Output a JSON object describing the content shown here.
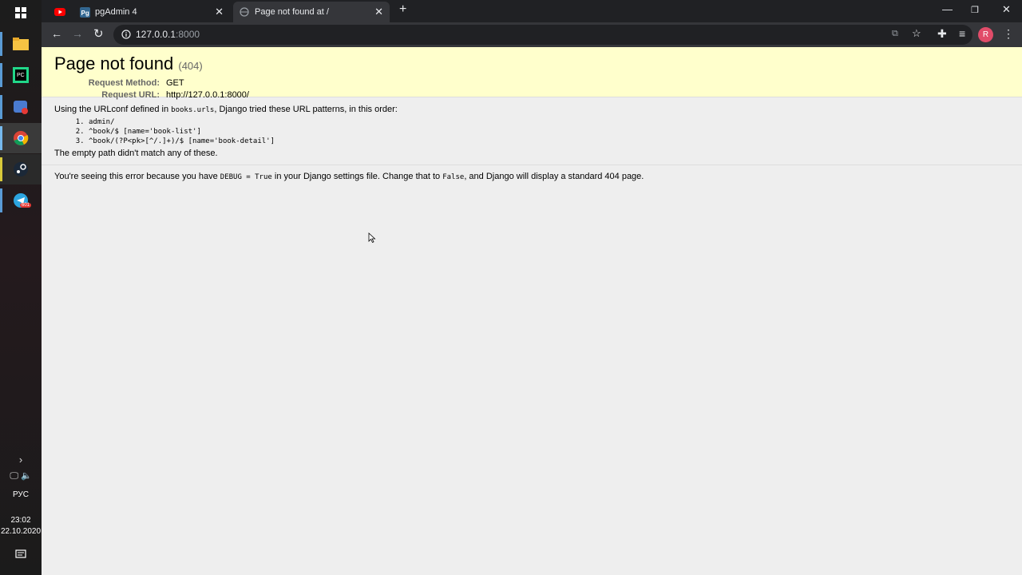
{
  "taskbar": {
    "language": "РУС",
    "time": "23:02",
    "date": "22.10.2020",
    "notification_count": "1",
    "telegram_badge": "601"
  },
  "tabs": [
    {
      "title": ""
    },
    {
      "title": "pgAdmin 4"
    },
    {
      "title": "Page not found at /"
    }
  ],
  "address_bar": {
    "host": "127.0.0.1",
    "port": ":8000"
  },
  "profile_initial": "R",
  "page": {
    "title": "Page not found",
    "status": "(404)",
    "request_method_label": "Request Method:",
    "request_method": "GET",
    "request_url_label": "Request URL:",
    "request_url": "http://127.0.0.1:8000/",
    "urlconf_prefix": "Using the URLconf defined in ",
    "urlconf_module": "books.urls",
    "urlconf_suffix": ", Django tried these URL patterns, in this order:",
    "patterns": [
      "admin/",
      "^book/$ [name='book-list']",
      "^book/(?P<pk>[^/.]+)/$ [name='book-detail']"
    ],
    "no_match": "The empty path didn't match any of these.",
    "debug_prefix": "You're seeing this error because you have ",
    "debug_code": "DEBUG = True",
    "debug_mid": " in your Django settings file. Change that to ",
    "false_code": "False",
    "debug_suffix": ", and Django will display a standard 404 page."
  }
}
